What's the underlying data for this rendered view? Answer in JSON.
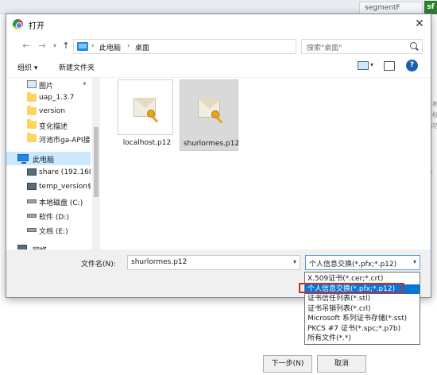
{
  "background": {
    "tab_label": "segmentF",
    "badge": "sf",
    "side_texts": [
      "发布",
      "会标",
      "化功",
      "的"
    ],
    "next_button": "下一步(N)",
    "cancel_button": "取消"
  },
  "dialog": {
    "title": "打开",
    "close": "✕",
    "address": {
      "crumbs": [
        "此电脑",
        "桌面"
      ],
      "separator": "›"
    },
    "search": {
      "placeholder": "搜索\"桌面\""
    },
    "toolbar": {
      "organize": "组织 ▾",
      "new_folder": "新建文件夹",
      "help": "?"
    },
    "nav": {
      "items": [
        {
          "label": "图片",
          "icon": "pictures-icon",
          "pinned": true
        },
        {
          "label": "uap_1.3.7",
          "icon": "folder-icon"
        },
        {
          "label": "version",
          "icon": "folder-icon"
        },
        {
          "label": "变化描述",
          "icon": "folder-icon"
        },
        {
          "label": "河池市ga-API接",
          "icon": "folder-icon"
        },
        {
          "label": "此电脑",
          "icon": "computer-icon",
          "selected": true
        },
        {
          "label": "share (192.168",
          "icon": "network-drive-icon"
        },
        {
          "label": "temp_version$",
          "icon": "network-drive-icon"
        },
        {
          "label": "本地磁盘 (C:)",
          "icon": "drive-icon"
        },
        {
          "label": "软件 (D:)",
          "icon": "drive-icon"
        },
        {
          "label": "文档 (E:)",
          "icon": "drive-icon"
        },
        {
          "label": "网络",
          "icon": "network-icon"
        }
      ]
    },
    "files": [
      {
        "name": "localhost.p12",
        "icon": "certificate-icon"
      },
      {
        "name": "shurlormes.p12",
        "icon": "certificate-icon",
        "hovered": true
      }
    ],
    "filename": {
      "label": "文件名(N):",
      "value": "shurlormes.p12"
    },
    "filter": {
      "selected": "个人信息交换(*.pfx;*.p12)",
      "options": [
        "X.509证书(*.cer;*.crt)",
        "个人信息交换(*.pfx;*.p12)",
        "证书信任列表(*.stl)",
        "证书吊销列表(*.crl)",
        "Microsoft 系列证书存储(*.sst)",
        "PKCS #7 证书(*.spc;*.p7b)",
        "所有文件(*.*)"
      ],
      "highlighted_index": 1
    }
  },
  "colors": {
    "selection": "#0078d7",
    "nav_selected": "#cce8ff",
    "highlight_box": "#e02424"
  }
}
